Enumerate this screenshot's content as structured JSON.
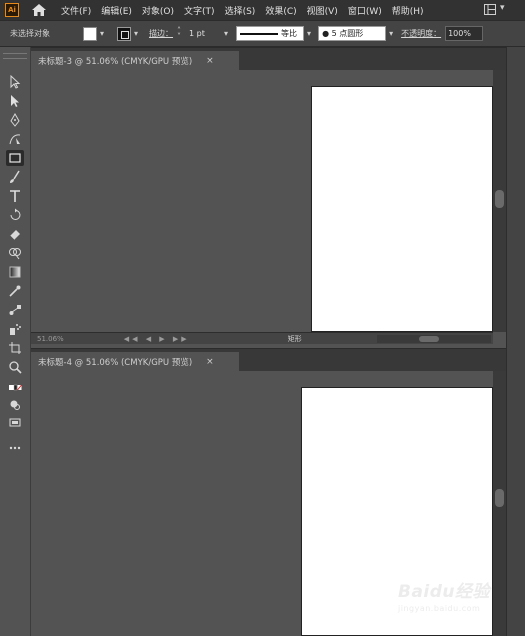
{
  "app": {
    "logo": "Ai"
  },
  "menu": [
    "文件(F)",
    "编辑(E)",
    "对象(O)",
    "文字(T)",
    "选择(S)",
    "效果(C)",
    "视图(V)",
    "窗口(W)",
    "帮助(H)"
  ],
  "control_bar": {
    "selection_label": "未选择对象",
    "stroke_label": "描边：",
    "stroke_weight": "1 pt",
    "line_style_label": "等比",
    "brush_label": "● 5 点圆形",
    "opacity_label": "不透明度：",
    "opacity_value": "100%"
  },
  "toolbar": {
    "tools": [
      "selection-tool",
      "direct-selection-tool",
      "pen-tool",
      "curvature-tool",
      "rectangle-tool",
      "paintbrush-tool",
      "type-tool",
      "rotate-tool",
      "eraser-tool",
      "shape-builder-tool",
      "gradient-tool",
      "eyedropper-tool",
      "blend-tool",
      "symbol-sprayer-tool",
      "artboard-tool",
      "zoom-tool",
      "fill-stroke-swatches",
      "draw-mode",
      "screen-mode",
      "more-tools"
    ]
  },
  "documents": [
    {
      "tab_title": "未标题-3 @ 51.06% (CMYK/GPU 预览)",
      "close": "×",
      "status_zoom": "51.06%",
      "status_label": "矩形"
    },
    {
      "tab_title": "未标题-4 @ 51.06% (CMYK/GPU 预览)",
      "close": "×"
    }
  ],
  "watermark": {
    "brand": "Baidu经验",
    "url": "jingyan.baidu.com"
  },
  "colors": {
    "menubar": "#323232",
    "controlbar": "#444444",
    "canvas": "#535353",
    "artboard": "#ffffff",
    "brand": "#e88a1a"
  }
}
